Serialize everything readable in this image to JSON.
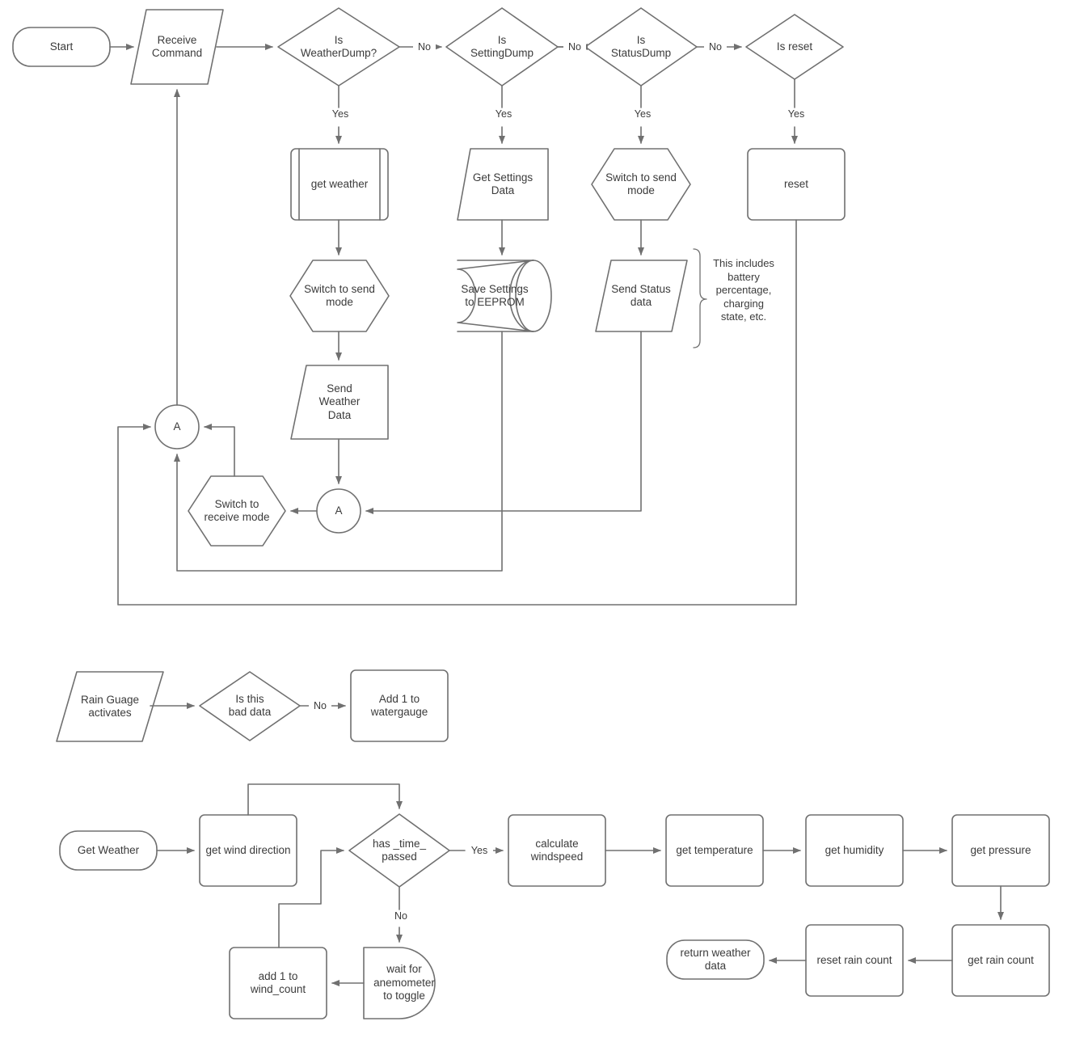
{
  "diagram": {
    "title": "Weather Station Firmware Flowchart",
    "stroke_color": "#707070",
    "text_color": "#3b3b3b",
    "background": "#ffffff",
    "flows": [
      {
        "id": "command-loop",
        "nodes": [
          {
            "id": "start",
            "label": "Start",
            "shape": "terminator"
          },
          {
            "id": "receive-command",
            "label": "Receive\nCommand",
            "shape": "parallelogram"
          },
          {
            "id": "is-weatherdump",
            "label": "Is\nWeatherDump?",
            "shape": "decision"
          },
          {
            "id": "is-settingdump",
            "label": "Is\nSettingDump",
            "shape": "decision"
          },
          {
            "id": "is-statusdump",
            "label": "Is\nStatusDump",
            "shape": "decision"
          },
          {
            "id": "is-reset",
            "label": "Is reset",
            "shape": "decision"
          },
          {
            "id": "get-weather-sub",
            "label": "get weather",
            "shape": "predefined-process"
          },
          {
            "id": "get-settings-data",
            "label": "Get Settings\nData",
            "shape": "trapezoid"
          },
          {
            "id": "switch-to-send-mode-status",
            "label": "Switch to send\nmode",
            "shape": "hexagon"
          },
          {
            "id": "reset",
            "label": "reset",
            "shape": "process"
          },
          {
            "id": "switch-to-send-mode-weather",
            "label": "Switch to send\nmode",
            "shape": "hexagon"
          },
          {
            "id": "save-settings-eeprom",
            "label": "Save Settings\nto EEPROM",
            "shape": "cylinder"
          },
          {
            "id": "send-status-data",
            "label": "Send Status\ndata",
            "shape": "parallelogram"
          },
          {
            "id": "send-weather-data",
            "label": "Send\nWeather\nData",
            "shape": "trapezoid"
          },
          {
            "id": "connector-a-top",
            "label": "A",
            "shape": "connector"
          },
          {
            "id": "connector-a-bottom",
            "label": "A",
            "shape": "connector"
          },
          {
            "id": "switch-to-receive-mode",
            "label": "Switch to\nreceive mode",
            "shape": "hexagon"
          }
        ],
        "edge_labels": [
          {
            "id": "no-1",
            "label": "No"
          },
          {
            "id": "no-2",
            "label": "No"
          },
          {
            "id": "no-3",
            "label": "No"
          },
          {
            "id": "yes-1",
            "label": "Yes"
          },
          {
            "id": "yes-2",
            "label": "Yes"
          },
          {
            "id": "yes-3",
            "label": "Yes"
          },
          {
            "id": "yes-4",
            "label": "Yes"
          }
        ],
        "annotations": [
          {
            "id": "status-note",
            "label": "This includes\nbattery\npercentage,\ncharging\nstate, etc."
          }
        ]
      },
      {
        "id": "rain-gauge",
        "nodes": [
          {
            "id": "rain-guage-activates",
            "label": "Rain Guage\nactivates",
            "shape": "parallelogram"
          },
          {
            "id": "is-this-bad-data",
            "label": "Is this\nbad data",
            "shape": "decision"
          },
          {
            "id": "add-1-to-watergauge",
            "label": "Add 1 to\nwatergauge",
            "shape": "process"
          }
        ],
        "edge_labels": [
          {
            "id": "no-rain",
            "label": "No"
          }
        ]
      },
      {
        "id": "get-weather",
        "nodes": [
          {
            "id": "get-weather-start",
            "label": "Get Weather",
            "shape": "terminator"
          },
          {
            "id": "get-wind-direction",
            "label": "get wind direction",
            "shape": "process"
          },
          {
            "id": "has-time-passed",
            "label": "has _time_\npassed",
            "shape": "decision"
          },
          {
            "id": "calculate-windspeed",
            "label": "calculate\nwindspeed",
            "shape": "process"
          },
          {
            "id": "get-temperature",
            "label": "get temperature",
            "shape": "process"
          },
          {
            "id": "get-humidity",
            "label": "get humidity",
            "shape": "process"
          },
          {
            "id": "get-pressure",
            "label": "get pressure",
            "shape": "process"
          },
          {
            "id": "get-rain-count",
            "label": "get rain count",
            "shape": "process"
          },
          {
            "id": "reset-rain-count",
            "label": "reset rain count",
            "shape": "process"
          },
          {
            "id": "return-weather-data",
            "label": "return weather\ndata",
            "shape": "terminator"
          },
          {
            "id": "add-1-to-wind-count",
            "label": "add 1 to\nwind_count",
            "shape": "process"
          },
          {
            "id": "wait-for-anemometer",
            "label": "wait for\nanemometer\nto toggle",
            "shape": "delay"
          }
        ],
        "edge_labels": [
          {
            "id": "yes-time",
            "label": "Yes"
          },
          {
            "id": "no-time",
            "label": "No"
          }
        ]
      }
    ]
  }
}
